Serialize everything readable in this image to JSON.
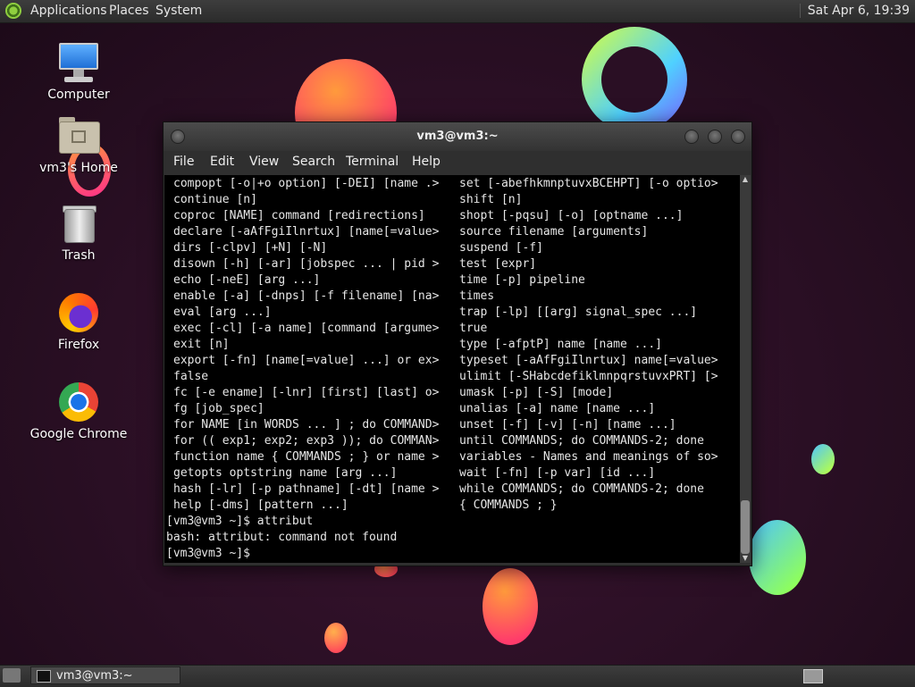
{
  "top_panel": {
    "menus": [
      "Applications",
      "Places",
      "System"
    ],
    "clock": "Sat Apr 6, 19:39"
  },
  "desktop_icons": [
    {
      "label": "Computer",
      "icon": "computer-icon"
    },
    {
      "label": "vm3's Home",
      "icon": "home-folder-icon"
    },
    {
      "label": "Trash",
      "icon": "trash-icon"
    },
    {
      "label": "Firefox",
      "icon": "firefox-icon"
    },
    {
      "label": "Google Chrome",
      "icon": "chrome-icon"
    }
  ],
  "terminal": {
    "title": "vm3@vm3:~",
    "menu": [
      "File",
      "Edit",
      "View",
      "Search",
      "Terminal",
      "Help"
    ],
    "left_column": [
      "compopt [-o|+o option] [-DEI] [name .>",
      "continue [n]",
      "coproc [NAME] command [redirections]",
      "declare [-aAfFgiIlnrtux] [name[=value>",
      "dirs [-clpv] [+N] [-N]",
      "disown [-h] [-ar] [jobspec ... | pid >",
      "echo [-neE] [arg ...]",
      "enable [-a] [-dnps] [-f filename] [na>",
      "eval [arg ...]",
      "exec [-cl] [-a name] [command [argume>",
      "exit [n]",
      "export [-fn] [name[=value] ...] or ex>",
      "false",
      "fc [-e ename] [-lnr] [first] [last] o>",
      "fg [job_spec]",
      "for NAME [in WORDS ... ] ; do COMMAND>",
      "for (( exp1; exp2; exp3 )); do COMMAN>",
      "function name { COMMANDS ; } or name >",
      "getopts optstring name [arg ...]",
      "hash [-lr] [-p pathname] [-dt] [name >",
      "help [-dms] [pattern ...]"
    ],
    "right_column": [
      "set [-abefhkmnptuvxBCEHPT] [-o optio>",
      "shift [n]",
      "shopt [-pqsu] [-o] [optname ...]",
      "source filename [arguments]",
      "suspend [-f]",
      "test [expr]",
      "time [-p] pipeline",
      "times",
      "trap [-lp] [[arg] signal_spec ...]",
      "true",
      "type [-afptP] name [name ...]",
      "typeset [-aAfFgiIlnrtux] name[=value>",
      "ulimit [-SHabcdefiklmnpqrstuvxPRT] [>",
      "umask [-p] [-S] [mode]",
      "unalias [-a] name [name ...]",
      "unset [-f] [-v] [-n] [name ...]",
      "until COMMANDS; do COMMANDS-2; done",
      "variables - Names and meanings of so>",
      "wait [-fn] [-p var] [id ...]",
      "while COMMANDS; do COMMANDS-2; done",
      "{ COMMANDS ; }"
    ],
    "tail_lines": [
      "[vm3@vm3 ~]$ attribut",
      "bash: attribut: command not found",
      "[vm3@vm3 ~]$"
    ]
  },
  "bottom_panel": {
    "task_label": "vm3@vm3:~"
  }
}
